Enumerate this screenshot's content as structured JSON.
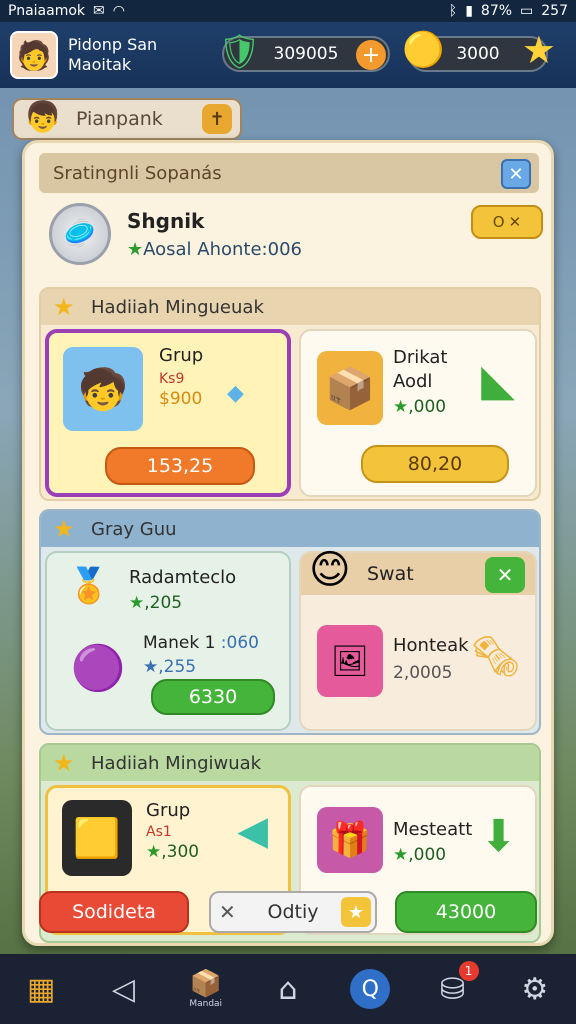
{
  "status": {
    "left_text": "Pnaiaamok",
    "right_text": "257",
    "battery": "87%"
  },
  "player": {
    "name": "Pidonp San Maoitak"
  },
  "currency": {
    "gems": "309005",
    "coins": "3000"
  },
  "background_tab": {
    "label": "Pianpank"
  },
  "panel": {
    "title": "Sratingnli Sopanás",
    "user": {
      "name": "Shgnik",
      "stat": "Aosal Ahonte:006",
      "btn_label": "O"
    },
    "section1": {
      "title": "Hadiiah Mingueuak",
      "card1": {
        "title": "Grup",
        "sub1": "Ks9",
        "sub2": "$900",
        "price": "153,25"
      },
      "card2": {
        "title": "Drikat",
        "sub1": "Aodl",
        "value": ",000",
        "price": "80,20"
      }
    },
    "section2": {
      "title": "Gray Guu",
      "card1": {
        "title": "Radamteclo",
        "value": ",205",
        "item2_title": "Manek 1",
        "item2_value": ":060",
        "item2_sub": ",255",
        "price": "6330"
      },
      "card2": {
        "title": "Swat",
        "item_title": "Honteak",
        "item_value": "2,0005"
      }
    },
    "section3": {
      "title": "Hadiiah Mingiwuak",
      "card1": {
        "title": "Grup",
        "sub": "As1",
        "value": ",300"
      },
      "card2": {
        "title": "Mesteatt",
        "value": ",000"
      }
    },
    "bottom": {
      "left_label": "Sodideta",
      "mid_label": "Odtiy",
      "right_label": "43000"
    }
  },
  "nav": {
    "center_label": "Mandai",
    "badge": "1"
  },
  "colors": {
    "orange": "#f07a2a",
    "yellow": "#f3c43a",
    "green": "#45b43a",
    "red": "#e84a35"
  }
}
